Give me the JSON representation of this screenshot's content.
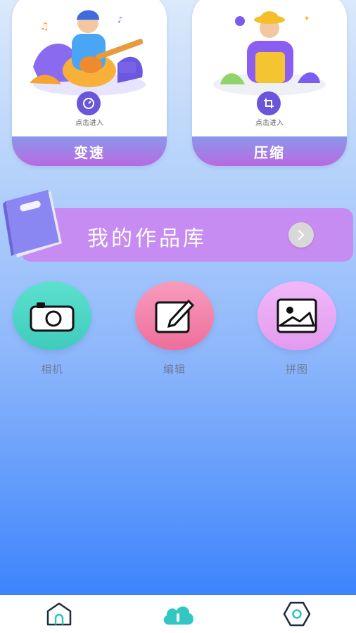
{
  "cards": [
    {
      "label": "变速",
      "hint": "点击进入",
      "icon": "speed-icon",
      "illustration": "guitarist-illustration"
    },
    {
      "label": "压缩",
      "hint": "点击进入",
      "icon": "crop-icon",
      "illustration": "person-illustration"
    }
  ],
  "works": {
    "label": "我的作品库",
    "icon": "book-icon",
    "arrow": "chevron-right-icon"
  },
  "tools": [
    {
      "label": "相机",
      "icon": "camera-icon",
      "color": "#49d6c4"
    },
    {
      "label": "编辑",
      "icon": "edit-icon",
      "color": "#f079a8"
    },
    {
      "label": "拼图",
      "icon": "image-icon",
      "color": "#e9a7f4"
    }
  ],
  "nav": [
    {
      "icon": "home-icon"
    },
    {
      "icon": "cloud-icon"
    },
    {
      "icon": "settings-icon"
    }
  ],
  "colors": {
    "accent": "#c78cf2",
    "card_footer_start": "#8a97ec",
    "card_footer_end": "#b86ae0"
  }
}
